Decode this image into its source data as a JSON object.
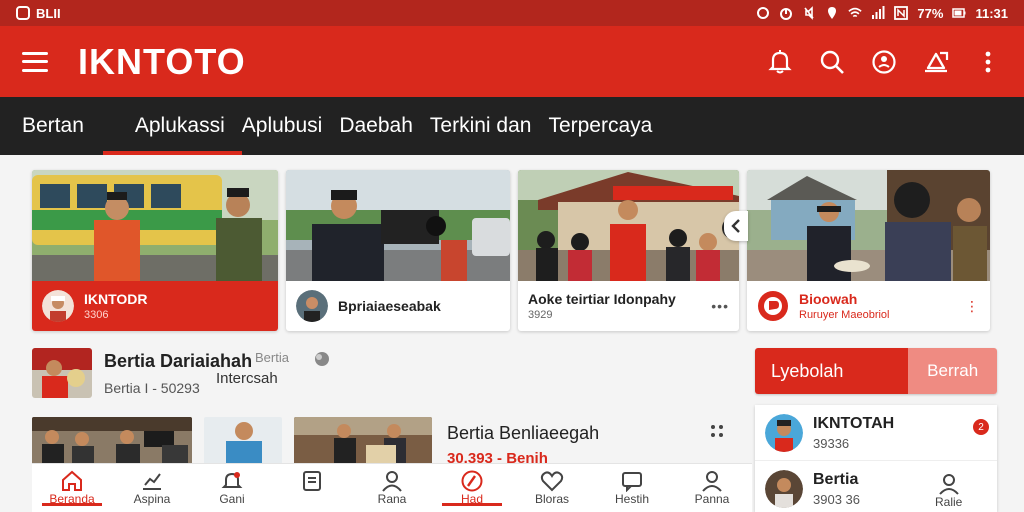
{
  "status_bar": {
    "left_text": "BLII",
    "battery": "77%",
    "time": "11:31"
  },
  "app": {
    "title": "IKNTOTO"
  },
  "tabs": [
    {
      "label": "Bertan"
    },
    {
      "label": "Aplukassi"
    },
    {
      "label": "Aplubusi"
    },
    {
      "label": "Daebah"
    },
    {
      "label": "Terkini dan"
    },
    {
      "label": "Terpercaya"
    }
  ],
  "cards": [
    {
      "title": "IKNTODR",
      "sub": "3306"
    },
    {
      "title": "Bpriaiaeseabak",
      "sub": ""
    },
    {
      "title": "Aoke teirtiar Idonpahy",
      "sub": "3929"
    },
    {
      "title": "Bioowah",
      "sub": "Ruruyer Maeobriol"
    }
  ],
  "feed": {
    "title": "Bertia Dariaiahah",
    "subtitle": "Bertia I - 50293",
    "extra_label": "Bertia",
    "extra_label2": "Intercsah"
  },
  "row2": {
    "title": "Bertia Benliaeegah",
    "subtitle": "30.393 - Benih"
  },
  "right_panel": {
    "seg_primary": "Lyebolah",
    "seg_secondary": "Berrah",
    "items": [
      {
        "title": "IKNTOTAH",
        "sub": "39336",
        "badge": "2"
      },
      {
        "title": "Bertia",
        "sub": "3903 36"
      }
    ]
  },
  "bottom_nav": [
    {
      "label": "Beranda",
      "icon": "home-icon"
    },
    {
      "label": "Aspina",
      "icon": "chart-icon"
    },
    {
      "label": "Gani",
      "icon": "bell-icon"
    },
    {
      "label": "",
      "icon": "document-icon"
    },
    {
      "label": "Rana",
      "icon": "person-icon"
    },
    {
      "label": "Had",
      "icon": "compass-icon"
    },
    {
      "label": "Bloras",
      "icon": "heart-icon"
    },
    {
      "label": "Hestih",
      "icon": "message-icon"
    },
    {
      "label": "Panna",
      "icon": "user-icon"
    }
  ],
  "bottom_nav_extra": {
    "label": "Ralie",
    "icon": "profile-icon"
  },
  "colors": {
    "brand_red": "#d9291c",
    "status_bar": "#b2261d",
    "tab_bar": "#222222"
  }
}
